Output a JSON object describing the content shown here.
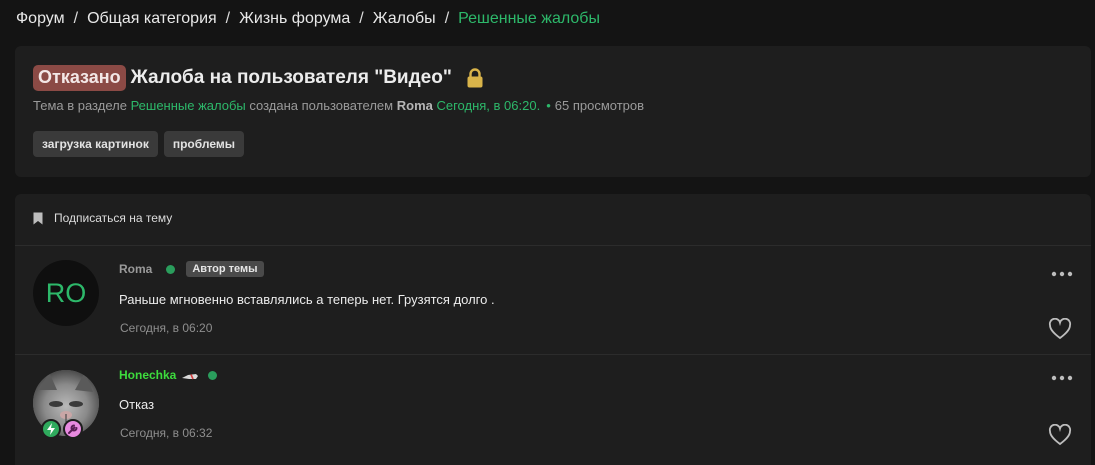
{
  "breadcrumb": {
    "items": [
      {
        "label": "Форум"
      },
      {
        "label": "Общая категория"
      },
      {
        "label": "Жизнь форума"
      },
      {
        "label": "Жалобы"
      },
      {
        "label": "Решенные жалобы"
      }
    ],
    "separator": "/"
  },
  "thread": {
    "prefix": "Отказано",
    "title": "Жалоба на пользователя \"Видео\"",
    "meta": {
      "prefix_text": "Тема в разделе",
      "section": "Решенные жалобы",
      "created_by_text": "создана пользователем",
      "author": "Roma",
      "date": "Сегодня, в 06:20.",
      "views": "65 просмотров"
    },
    "tags": [
      "загрузка картинок",
      "проблемы"
    ]
  },
  "watch": {
    "label": "Подписаться на тему"
  },
  "posts": [
    {
      "avatar_initials": "RO",
      "author": "Roma",
      "author_color": "#9a9a9a",
      "badge": "Автор темы",
      "body": "Раньше мгновенно вставлялись а теперь нет. Грузятся долго .",
      "date": "Сегодня, в 06:20"
    },
    {
      "author": "Honechka",
      "author_color": "#3ddc3d",
      "body": "Отказ",
      "date": "Сегодня, в 06:32"
    }
  ],
  "colors": {
    "accent": "#2db86a",
    "prefix_bg": "#8b4a45",
    "lock": "#d9b44a"
  },
  "icons": {
    "lock": "lock-icon",
    "bookmark": "bookmark-icon",
    "more": "more-icon",
    "like": "heart-icon"
  }
}
